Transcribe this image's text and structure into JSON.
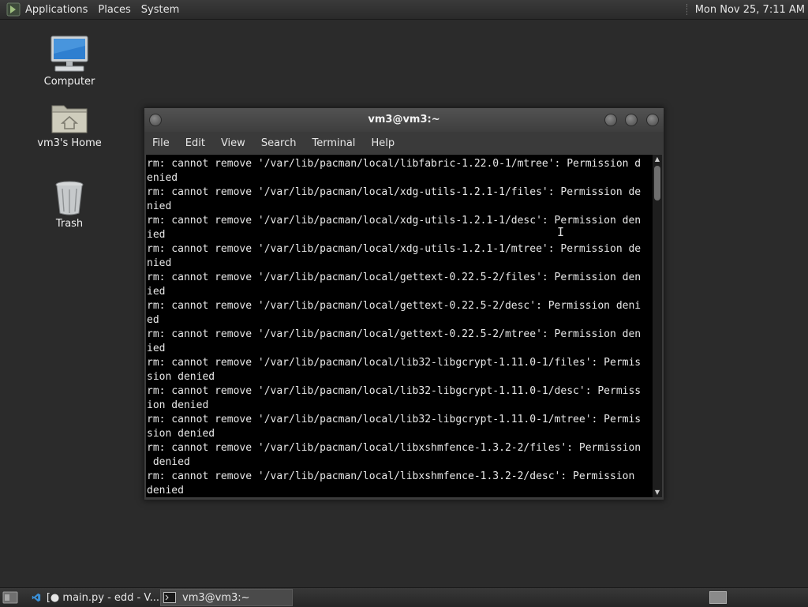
{
  "top_panel": {
    "menus": [
      "Applications",
      "Places",
      "System"
    ],
    "clock": "Mon Nov 25,  7:11 AM"
  },
  "desktop": {
    "icons": [
      {
        "label": "Computer",
        "icon": "computer-icon"
      },
      {
        "label": "vm3's Home",
        "icon": "home-folder-icon"
      },
      {
        "label": "Trash",
        "icon": "trash-icon"
      }
    ]
  },
  "terminal": {
    "title": "vm3@vm3:~",
    "menus": [
      "File",
      "Edit",
      "View",
      "Search",
      "Terminal",
      "Help"
    ],
    "lines": [
      "rm: cannot remove '/var/lib/pacman/local/libfabric-1.22.0-1/mtree': Permission d",
      "enied",
      "rm: cannot remove '/var/lib/pacman/local/xdg-utils-1.2.1-1/files': Permission de",
      "nied",
      "rm: cannot remove '/var/lib/pacman/local/xdg-utils-1.2.1-1/desc': Permission den",
      "ied",
      "rm: cannot remove '/var/lib/pacman/local/xdg-utils-1.2.1-1/mtree': Permission de",
      "nied",
      "rm: cannot remove '/var/lib/pacman/local/gettext-0.22.5-2/files': Permission den",
      "ied",
      "rm: cannot remove '/var/lib/pacman/local/gettext-0.22.5-2/desc': Permission deni",
      "ed",
      "rm: cannot remove '/var/lib/pacman/local/gettext-0.22.5-2/mtree': Permission den",
      "ied",
      "rm: cannot remove '/var/lib/pacman/local/lib32-libgcrypt-1.11.0-1/files': Permis",
      "sion denied",
      "rm: cannot remove '/var/lib/pacman/local/lib32-libgcrypt-1.11.0-1/desc': Permiss",
      "ion denied",
      "rm: cannot remove '/var/lib/pacman/local/lib32-libgcrypt-1.11.0-1/mtree': Permis",
      "sion denied",
      "rm: cannot remove '/var/lib/pacman/local/libxshmfence-1.3.2-2/files': Permission",
      " denied",
      "rm: cannot remove '/var/lib/pacman/local/libxshmfence-1.3.2-2/desc': Permission ",
      "denied"
    ]
  },
  "taskbar": {
    "tasks": [
      {
        "label": "[● main.py - edd - V...",
        "icon": "vscode-icon",
        "active": false
      },
      {
        "label": "vm3@vm3:~",
        "icon": "terminal-icon",
        "active": true
      }
    ]
  },
  "colors": {
    "desktop_bg": "#2b2b2b",
    "terminal_bg": "#000000",
    "terminal_fg": "#e8e8e8",
    "panel_bg": "#333333"
  }
}
